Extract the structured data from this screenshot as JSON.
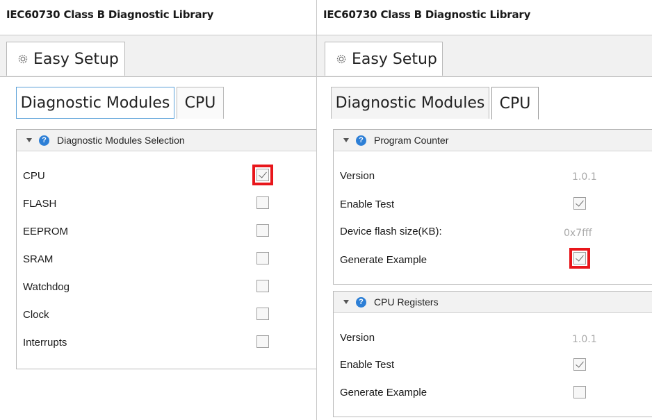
{
  "left": {
    "app_title": "IEC60730 Class B Diagnostic Library",
    "easy_setup_tab": "Easy Setup",
    "tabs": [
      "Diagnostic Modules",
      "CPU"
    ],
    "section": {
      "title": "Diagnostic Modules Selection",
      "rows": [
        {
          "label": "CPU",
          "checked": true,
          "highlighted": true
        },
        {
          "label": "FLASH",
          "checked": false
        },
        {
          "label": "EEPROM",
          "checked": false
        },
        {
          "label": "SRAM",
          "checked": false
        },
        {
          "label": "Watchdog",
          "checked": false
        },
        {
          "label": "Clock",
          "checked": false
        },
        {
          "label": "Interrupts",
          "checked": false
        }
      ]
    }
  },
  "right": {
    "app_title": "IEC60730 Class B Diagnostic Library",
    "easy_setup_tab": "Easy Setup",
    "tabs": [
      "Diagnostic Modules",
      "CPU"
    ],
    "program_counter": {
      "title": "Program Counter",
      "version_label": "Version",
      "version_value": "1.0.1",
      "enable_label": "Enable Test",
      "enable_checked": true,
      "flash_label": "Device flash size(KB):",
      "flash_value": "0x7fff",
      "example_label": "Generate Example",
      "example_checked": true,
      "example_highlighted": true
    },
    "cpu_registers": {
      "title": "CPU Registers",
      "version_label": "Version",
      "version_value": "1.0.1",
      "enable_label": "Enable Test",
      "enable_checked": true,
      "example_label": "Generate Example",
      "example_checked": false
    }
  },
  "colors": {
    "highlight": "#e8161b",
    "help_icon": "#2d7fd6",
    "active_tab_border": "#5aa0d8"
  }
}
